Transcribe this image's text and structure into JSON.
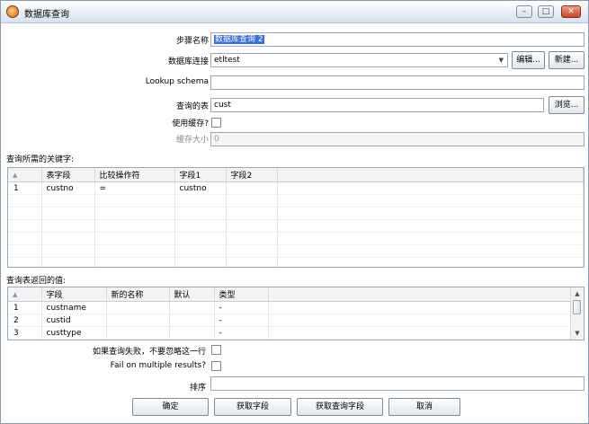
{
  "window": {
    "title": "数据库查询",
    "minimize_label": "–",
    "maximize_label": "□",
    "close_label": "✕"
  },
  "form": {
    "step_name_label": "步骤名称",
    "step_name_value": "数据库查询 2",
    "db_connection_label": "数据库连接",
    "db_connection_value": "etltest",
    "edit_button": "编辑...",
    "new_button": "新建...",
    "lookup_schema_label": "Lookup schema",
    "lookup_schema_value": "",
    "lookup_table_label": "查询的表",
    "lookup_table_value": "cust",
    "browse_button": "浏览...",
    "use_cache_label": "使用缓存?",
    "cache_size_label": "缓存大小",
    "cache_size_value": "0"
  },
  "keys": {
    "section_label": "查询所需的关键字:",
    "columns": [
      "表字段",
      "比较操作符",
      "字段1",
      "字段2"
    ],
    "rows": [
      {
        "num": "1",
        "cells": [
          "custno",
          "=",
          "custno",
          ""
        ]
      }
    ]
  },
  "returns": {
    "section_label": "查询表返回的值:",
    "columns": [
      "字段",
      "新的名称",
      "默认",
      "类型"
    ],
    "rows": [
      {
        "num": "1",
        "cells": [
          "custname",
          "",
          "",
          "-"
        ]
      },
      {
        "num": "2",
        "cells": [
          "custid",
          "",
          "",
          "-"
        ]
      },
      {
        "num": "3",
        "cells": [
          "custtype",
          "",
          "",
          "-"
        ]
      }
    ]
  },
  "options": {
    "fail_no_ignore_label": "如果查询失败，不要忽略这一行",
    "fail_multiple_label": "Fail on multiple results?",
    "order_label": "排序",
    "order_value": ""
  },
  "buttons": {
    "ok": "确定",
    "get_fields": "获取字段",
    "get_lookup_fields": "获取查询字段",
    "cancel": "取消"
  }
}
